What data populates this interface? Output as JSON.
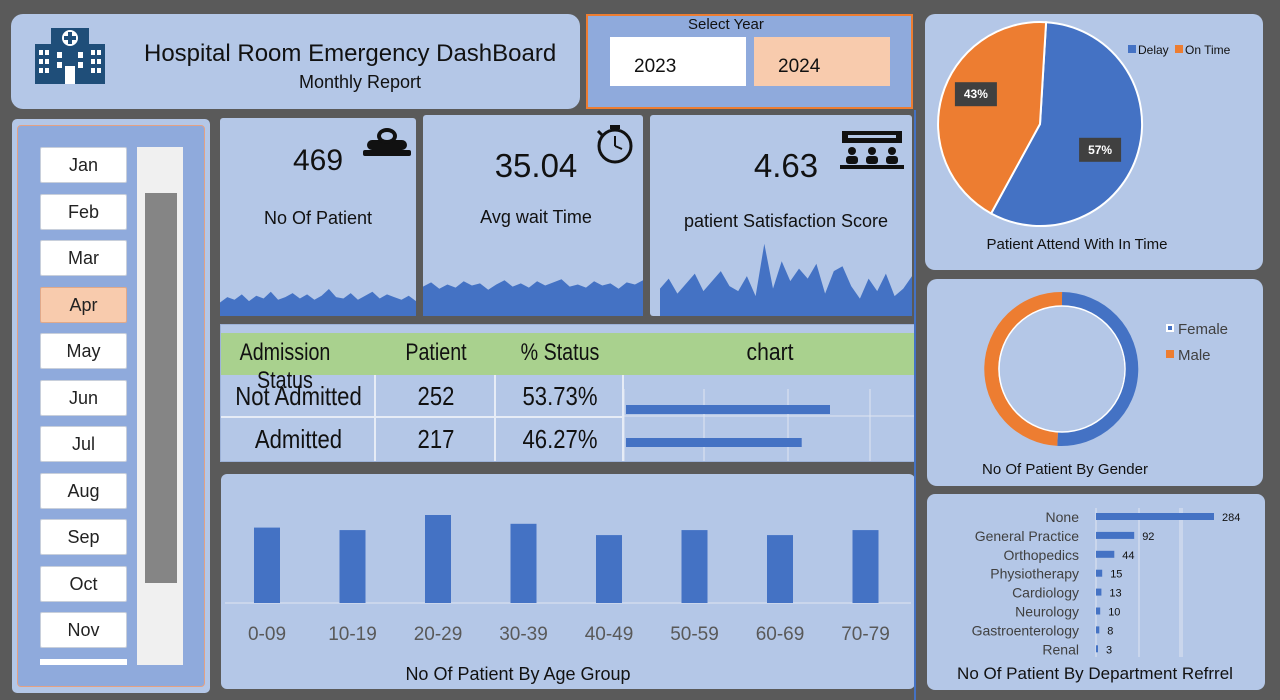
{
  "header": {
    "title": "Hospital Room Emergency DashBoard",
    "subtitle": "Monthly Report"
  },
  "year_slicer": {
    "label": "Select Year",
    "options": [
      "2023",
      "2024"
    ],
    "selected": "2024"
  },
  "month_slicer": {
    "items": [
      "Jan",
      "Feb",
      "Mar",
      "Apr",
      "May",
      "Jun",
      "Jul",
      "Aug",
      "Sep",
      "Oct",
      "Nov"
    ],
    "selected": "Apr"
  },
  "kpis": {
    "patients": {
      "value": "469",
      "label": "No Of Patient",
      "icon": "hospital-bed-icon"
    },
    "wait": {
      "value": "35.04",
      "label": "Avg wait Time",
      "icon": "stopwatch-icon"
    },
    "satisfaction": {
      "value": "4.63",
      "label": "patient Satisfaction Score",
      "icon": "audience-icon"
    }
  },
  "admission_table": {
    "headers": [
      "Admission Status",
      "Patient",
      "% Status",
      "chart"
    ],
    "rows": [
      {
        "status": "Not Admitted",
        "patient": "252",
        "pct": "53.73%",
        "bar": 0.5373
      },
      {
        "status": "Admitted",
        "patient": "217",
        "pct": "46.27%",
        "bar": 0.4627
      }
    ]
  },
  "colors": {
    "accent": "#4472c4",
    "orange": "#ed7d31",
    "panel": "#b4c7e7",
    "selected": "#f8cbad",
    "table_header": "#a9d18e"
  },
  "chart_data": [
    {
      "type": "pie",
      "title": "Patient Attend With In Time",
      "legend_position": "top-right",
      "categories": [
        "Delay",
        "On Time"
      ],
      "values": [
        57,
        43
      ],
      "labels": [
        "57%",
        "43%"
      ],
      "colors": [
        "#4472c4",
        "#ed7d31"
      ]
    },
    {
      "type": "pie",
      "subtype": "donut",
      "title": "No Of Patient By Gender",
      "legend_position": "top-right",
      "categories": [
        "Female",
        "Male"
      ],
      "values": [
        51,
        49
      ],
      "colors": [
        "#4472c4",
        "#ed7d31"
      ]
    },
    {
      "type": "bar",
      "orientation": "horizontal",
      "title": "No Of Patient By Department Refrrel",
      "categories": [
        "None",
        "General Practice",
        "Orthopedics",
        "Physiotherapy",
        "Cardiology",
        "Neurology",
        "Gastroenterology",
        "Renal"
      ],
      "values": [
        284,
        92,
        44,
        15,
        13,
        10,
        8,
        3
      ]
    },
    {
      "type": "bar",
      "title": "No Of Patient By Age Group",
      "categories": [
        "0-09",
        "10-19",
        "20-29",
        "30-39",
        "40-49",
        "50-59",
        "60-69",
        "70-79"
      ],
      "values": [
        60,
        58,
        70,
        63,
        54,
        58,
        54,
        58
      ]
    },
    {
      "type": "area",
      "name": "patients-trend",
      "values": [
        10,
        14,
        12,
        16,
        11,
        15,
        13,
        18,
        12,
        14,
        17,
        13,
        16,
        12,
        15,
        20,
        14,
        13,
        17,
        12,
        15,
        18,
        13,
        16,
        14,
        12,
        15,
        11
      ]
    },
    {
      "type": "area",
      "name": "wait-trend",
      "values": [
        28,
        32,
        26,
        30,
        27,
        33,
        29,
        31,
        25,
        30,
        34,
        28,
        31,
        27,
        33,
        29,
        32,
        35,
        28,
        30,
        27,
        33,
        29,
        31,
        26,
        32,
        30,
        34
      ]
    },
    {
      "type": "area",
      "name": "satisfaction-trend",
      "values": [
        22,
        30,
        18,
        26,
        34,
        20,
        28,
        36,
        24,
        20,
        32,
        16,
        58,
        22,
        44,
        28,
        38,
        30,
        42,
        18,
        36,
        40,
        24,
        14,
        30,
        20,
        34,
        16,
        22,
        32
      ]
    }
  ]
}
